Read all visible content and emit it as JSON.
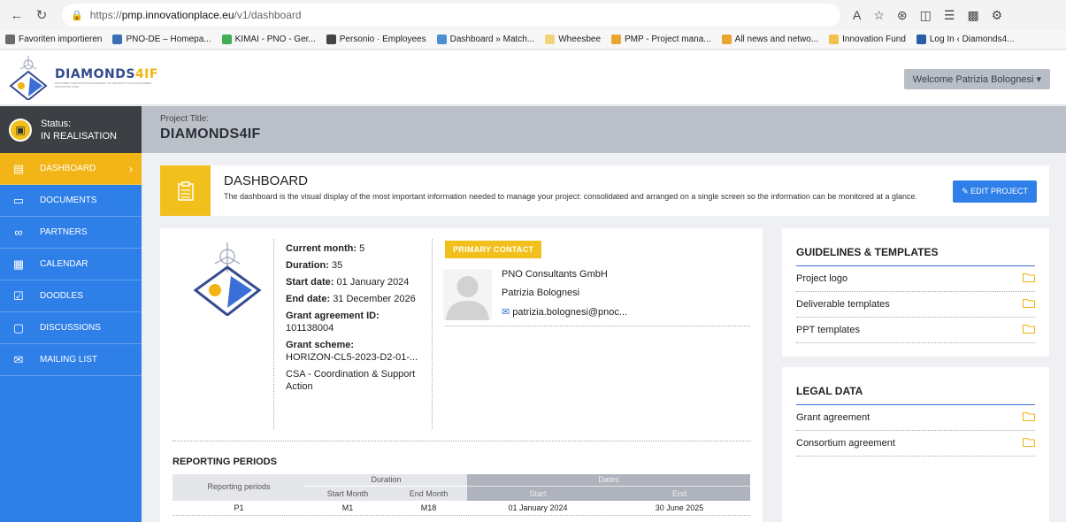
{
  "browser": {
    "url_prefix": "https://",
    "url_host": "pmp.innovationplace.eu",
    "url_path": "/v1/dashboard",
    "bookmarks": [
      {
        "label": "Favoriten importieren",
        "color": "#6b6b6b"
      },
      {
        "label": "PNO-DE – Homepa...",
        "color": "#3a6fb3"
      },
      {
        "label": "KIMAI - PNO - Ger...",
        "color": "#3fae55"
      },
      {
        "label": "Personio · Employees",
        "color": "#444444"
      },
      {
        "label": "Dashboard » Match...",
        "color": "#4a8fd1"
      },
      {
        "label": "Wheesbee",
        "color": "#f1d37a"
      },
      {
        "label": "PMP - Project mana...",
        "color": "#e8a52f"
      },
      {
        "label": "All news and netwo...",
        "color": "#e8a52f"
      },
      {
        "label": "Innovation Fund",
        "color": "#f1c24a"
      },
      {
        "label": "Log In ‹ Diamonds4...",
        "color": "#2a5fa8"
      }
    ]
  },
  "header": {
    "logo_name_main": "DIAMONDS",
    "logo_name_accent": "4IF",
    "logo_tagline": "DISCOVERY INNOVATION MANAGEMENT OF PROJECTS FOR SUSTAINABLE INNOVATION FUND",
    "welcome": "Welcome Patrizia Bolognesi"
  },
  "sidebar": {
    "status_label": "Status:",
    "status_value": "IN REALISATION",
    "items": [
      {
        "label": "DASHBOARD",
        "icon": "clipboard-icon"
      },
      {
        "label": "DOCUMENTS",
        "icon": "folder-icon"
      },
      {
        "label": "PARTNERS",
        "icon": "people-icon"
      },
      {
        "label": "CALENDAR",
        "icon": "calendar-icon"
      },
      {
        "label": "DOODLES",
        "icon": "checkbox-calendar-icon"
      },
      {
        "label": "DISCUSSIONS",
        "icon": "chat-icon"
      },
      {
        "label": "MAILING LIST",
        "icon": "mail-list-icon"
      }
    ]
  },
  "title_bar": {
    "label": "Project Title:",
    "title": "DIAMONDS4IF"
  },
  "banner": {
    "title": "DASHBOARD",
    "description": "The dashboard is the visual display of the most important information needed to manage your project: consolidated and arranged on a single screen so the information can be monitored at a glance.",
    "edit_button": "EDIT PROJECT"
  },
  "project_info": {
    "current_month_label": "Current month:",
    "current_month": "5",
    "duration_label": "Duration:",
    "duration": "35",
    "start_label": "Start date:",
    "start_date": "01 January 2024",
    "end_label": "End date:",
    "end_date": "31 December 2026",
    "grant_id_label": "Grant agreement ID:",
    "grant_id": "101138004",
    "grant_scheme_label": "Grant scheme:",
    "grant_scheme": "HORIZON-CL5-2023-D2-01-...",
    "action_type": "CSA - Coordination & Support Action"
  },
  "contact": {
    "tag": "PRIMARY CONTACT",
    "company": "PNO Consultants GmbH",
    "name": "Patrizia Bolognesi",
    "email": "patrizia.bolognesi@pnoc..."
  },
  "reporting": {
    "title": "REPORTING PERIODS",
    "col_periods": "Reporting periods",
    "col_duration": "Duration",
    "col_dates": "Dates",
    "col_start_month": "Start Month",
    "col_end_month": "End Month",
    "col_start": "Start",
    "col_end": "End",
    "rows": [
      {
        "period": "P1",
        "start_month": "M1",
        "end_month": "M18",
        "start": "01 January 2024",
        "end": "30 June 2025"
      }
    ]
  },
  "guidelines": {
    "title": "GUIDELINES & TEMPLATES",
    "items": [
      "Project logo",
      "Deliverable templates",
      "PPT templates"
    ]
  },
  "legal": {
    "title": "LEGAL DATA",
    "items": [
      "Grant agreement",
      "Consortium agreement"
    ]
  },
  "colors": {
    "sidebar_blue": "#2f7fe8",
    "accent_yellow": "#f2c01c",
    "status_dark": "#3c3f44",
    "title_grey": "#bcc0c8"
  }
}
